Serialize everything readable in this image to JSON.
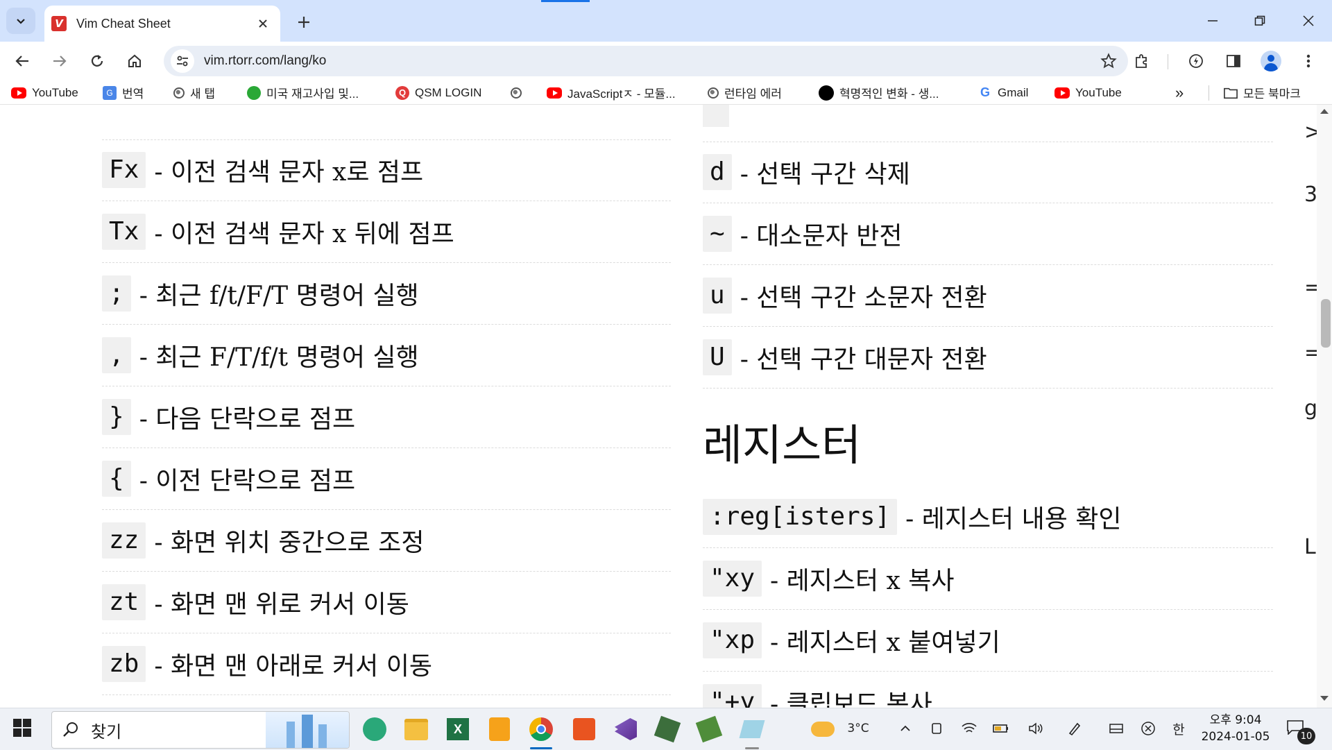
{
  "tab": {
    "favicon_letter": "V",
    "title": "Vim Cheat Sheet"
  },
  "toolbar": {
    "url": "vim.rtorr.com/lang/ko"
  },
  "bookmarks": [
    {
      "label": "YouTube",
      "icon": "youtube-icon"
    },
    {
      "label": "번역",
      "icon": "translate-icon"
    },
    {
      "label": "새 탭",
      "icon": "globe-icon"
    },
    {
      "label": "미국 재고사입 및...",
      "icon": "coffee-icon"
    },
    {
      "label": "QSM LOGIN",
      "icon": "qsm-icon"
    },
    {
      "label": "",
      "icon": "globe-icon"
    },
    {
      "label": "JavaScriptㅈ - 모듈...",
      "icon": "youtube-icon"
    },
    {
      "label": "런타임 에러",
      "icon": "globe-icon"
    },
    {
      "label": "혁명적인 변화 - 생...",
      "icon": "dot-icon"
    },
    {
      "label": "Gmail",
      "icon": "google-icon"
    },
    {
      "label": "YouTube",
      "icon": "youtube-icon"
    }
  ],
  "bookmarks_overflow": "»",
  "all_bookmarks": "모든 북마크",
  "left_rows": [
    {
      "key": "Fx",
      "desc": "- 이전 검색 문자 x로 점프"
    },
    {
      "key": "Tx",
      "desc": "- 이전 검색 문자 x 뒤에 점프"
    },
    {
      "key": ";",
      "desc": "- 최근 f/t/F/T 명령어 실행"
    },
    {
      "key": ",",
      "desc": "- 최근 F/T/f/t 명령어 실행"
    },
    {
      "key": "}",
      "desc": "- 다음 단락으로 점프"
    },
    {
      "key": "{",
      "desc": "- 이전 단락으로 점프"
    },
    {
      "key": "zz",
      "desc": "- 화면 위치 중간으로 조정"
    },
    {
      "key": "zt",
      "desc": "- 화면 맨 위로 커서 이동"
    },
    {
      "key": "zb",
      "desc": "- 화면 맨 아래로 커서 이동"
    }
  ],
  "right_rows_top": [
    {
      "key": "d",
      "desc": "- 선택 구간 삭제"
    },
    {
      "key": "~",
      "desc": "- 대소문자 반전"
    },
    {
      "key": "u",
      "desc": "- 선택 구간 소문자 전환"
    },
    {
      "key": "U",
      "desc": "- 선택 구간 대문자 전환"
    }
  ],
  "section_title": "레지스터",
  "right_rows_bottom": [
    {
      "key": ":reg[isters]",
      "desc": "- 레지스터 내용 확인"
    },
    {
      "key": "\"xy",
      "desc": "- 레지스터 x 복사"
    },
    {
      "key": "\"xp",
      "desc": "- 레지스터 x 붙여넣기"
    },
    {
      "key": "\"+y",
      "desc": "- 클립보드 복사"
    }
  ],
  "right_edge_glyphs": [
    ">",
    "3",
    "=",
    "=",
    "g",
    "L"
  ],
  "taskbar": {
    "search_text": "찾기",
    "weather_temp": "3°C",
    "ime": "한",
    "time": "오후 9:04",
    "date": "2024-01-05",
    "notif_count": "10"
  }
}
